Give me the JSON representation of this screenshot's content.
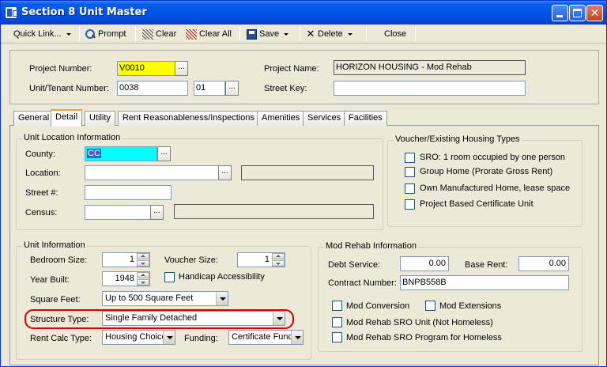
{
  "window": {
    "title": "Section 8 Unit Master"
  },
  "toolbar": {
    "quick_link": "Quick Link...",
    "prompt": "Prompt",
    "clear": "Clear",
    "clear_all": "Clear All",
    "save": "Save",
    "delete": "Delete",
    "close": "Close"
  },
  "header": {
    "project_number_label": "Project Number:",
    "project_number_value": "V0010",
    "project_name_label": "Project Name:",
    "project_name_value": "HORIZON HOUSING - Mod Rehab",
    "unit_tenant_label": "Unit/Tenant Number:",
    "unit_number_value": "0038",
    "tenant_suffix_value": "01",
    "street_key_label": "Street Key:",
    "street_key_value": ""
  },
  "tabs": [
    "General",
    "Detail",
    "Utility",
    "Rent Reasonableness/Inspections",
    "Amenities",
    "Services",
    "Facilities"
  ],
  "active_tab": "Detail",
  "location": {
    "title": "Unit Location Information",
    "county_label": "County:",
    "county_value": "CC",
    "location_label": "Location:",
    "street_label": "Street #:",
    "census_label": "Census:"
  },
  "voucher_types": {
    "title": "Voucher/Existing Housing Types",
    "options": [
      {
        "label": "SRO: 1 room occupied by one person",
        "checked": false
      },
      {
        "label": "Group Home (Prorate Gross Rent)",
        "checked": false
      },
      {
        "label": "Own Manufactured Home, lease space",
        "checked": false
      },
      {
        "label": "Project Based Certificate Unit",
        "checked": false
      }
    ]
  },
  "unit_info": {
    "title": "Unit Information",
    "bedroom_label": "Bedroom Size:",
    "bedroom_value": "1",
    "voucher_label": "Voucher Size:",
    "voucher_value": "1",
    "year_built_label": "Year Built:",
    "year_built_value": "1948",
    "handicap_label": "Handicap Accessibility",
    "square_feet_label": "Square Feet:",
    "square_feet_value": "Up to 500 Square Feet",
    "structure_label": "Structure Type:",
    "structure_value": "Single Family Detached",
    "rent_calc_label": "Rent Calc Type:",
    "rent_calc_value": "Housing Choice",
    "funding_label": "Funding:",
    "funding_value": "Certificate Func"
  },
  "mod_rehab": {
    "title": "Mod Rehab Information",
    "debt_label": "Debt Service:",
    "debt_value": "0.00",
    "base_rent_label": "Base Rent:",
    "base_rent_value": "0.00",
    "contract_label": "Contract Number:",
    "contract_value": "BNPB558B",
    "mod_conversion": "Mod Conversion",
    "mod_extensions": "Mod Extensions",
    "sro_unit": "Mod Rehab SRO Unit (Not Homeless)",
    "sro_program": "Mod Rehab SRO Program for Homeless"
  },
  "colors": {
    "titlebar": "#0055e5",
    "highlight": "#d40000",
    "project_field": "#ffff00",
    "county_field": "#00ffff"
  }
}
